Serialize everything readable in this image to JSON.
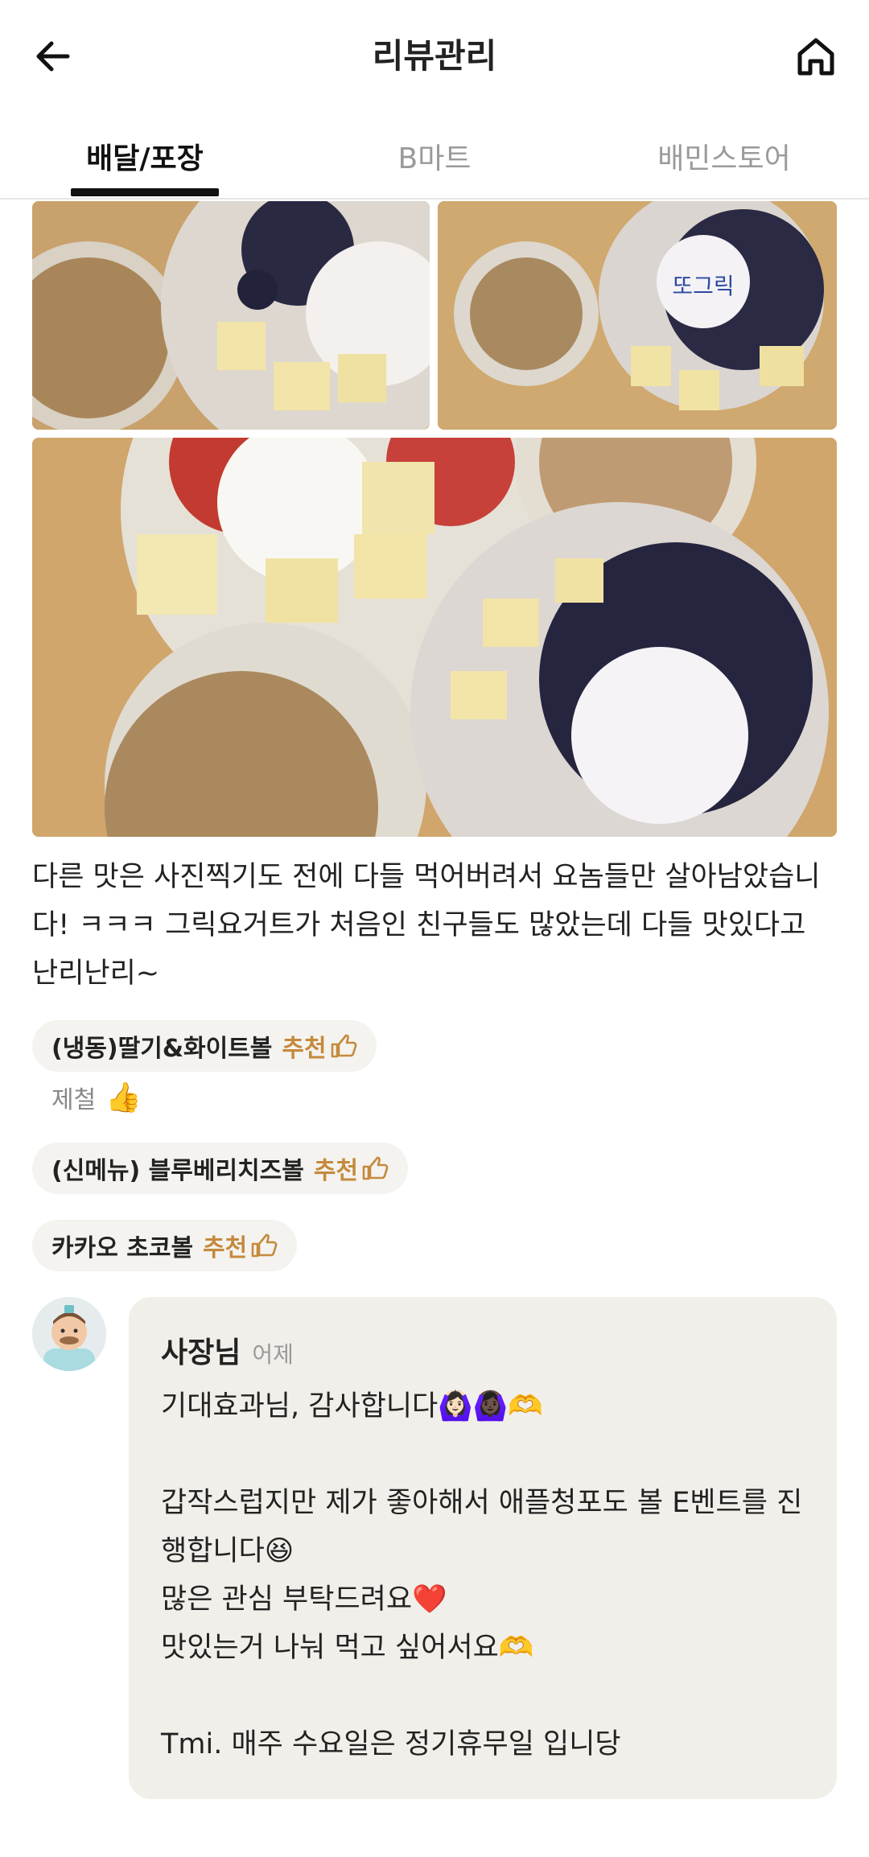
{
  "header": {
    "title": "리뷰관리",
    "back_icon": "arrow-left-icon",
    "home_icon": "home-icon"
  },
  "tabs": [
    {
      "label": "배달/포장",
      "active": true
    },
    {
      "label": "B마트",
      "active": false
    },
    {
      "label": "배민스토어",
      "active": false
    }
  ],
  "review": {
    "text": "다른 맛은 사진찍기도 전에 다들 먹어버려서 요놈들만 살아남았습니다! ㅋㅋㅋ 그릭요거트가 처음인 친구들도 많았는데 다들 맛있다고 난리난리~",
    "photo_sticker_text": "또그릭"
  },
  "menus": [
    {
      "name": "(냉동)딸기&화이트볼",
      "rec": "추천"
    },
    {
      "name": "(신메뉴) 블루베리치즈볼",
      "rec": "추천"
    },
    {
      "name": "카카오 초코볼",
      "rec": "추천"
    }
  ],
  "menu_note": "제철",
  "owner_reply": {
    "name": "사장님",
    "time": "어제",
    "body": "기대효과님, 감사합니다🙆🏻‍♀️🙆🏿‍♀️🫶\n\n갑작스럽지만 제가 좋아해서 애플청포도 볼 E벤트를 진행합니다😆\n많은 관심 부탁드려요❤️\n맛있는거 나눠 먹고 싶어서요🫶\n\nTmi. 매주 수요일은 정기휴무일 입니당"
  },
  "colors": {
    "accent": "#c58a3c",
    "chip_bg": "#f4f3f0",
    "reply_bg": "#f1efea"
  }
}
